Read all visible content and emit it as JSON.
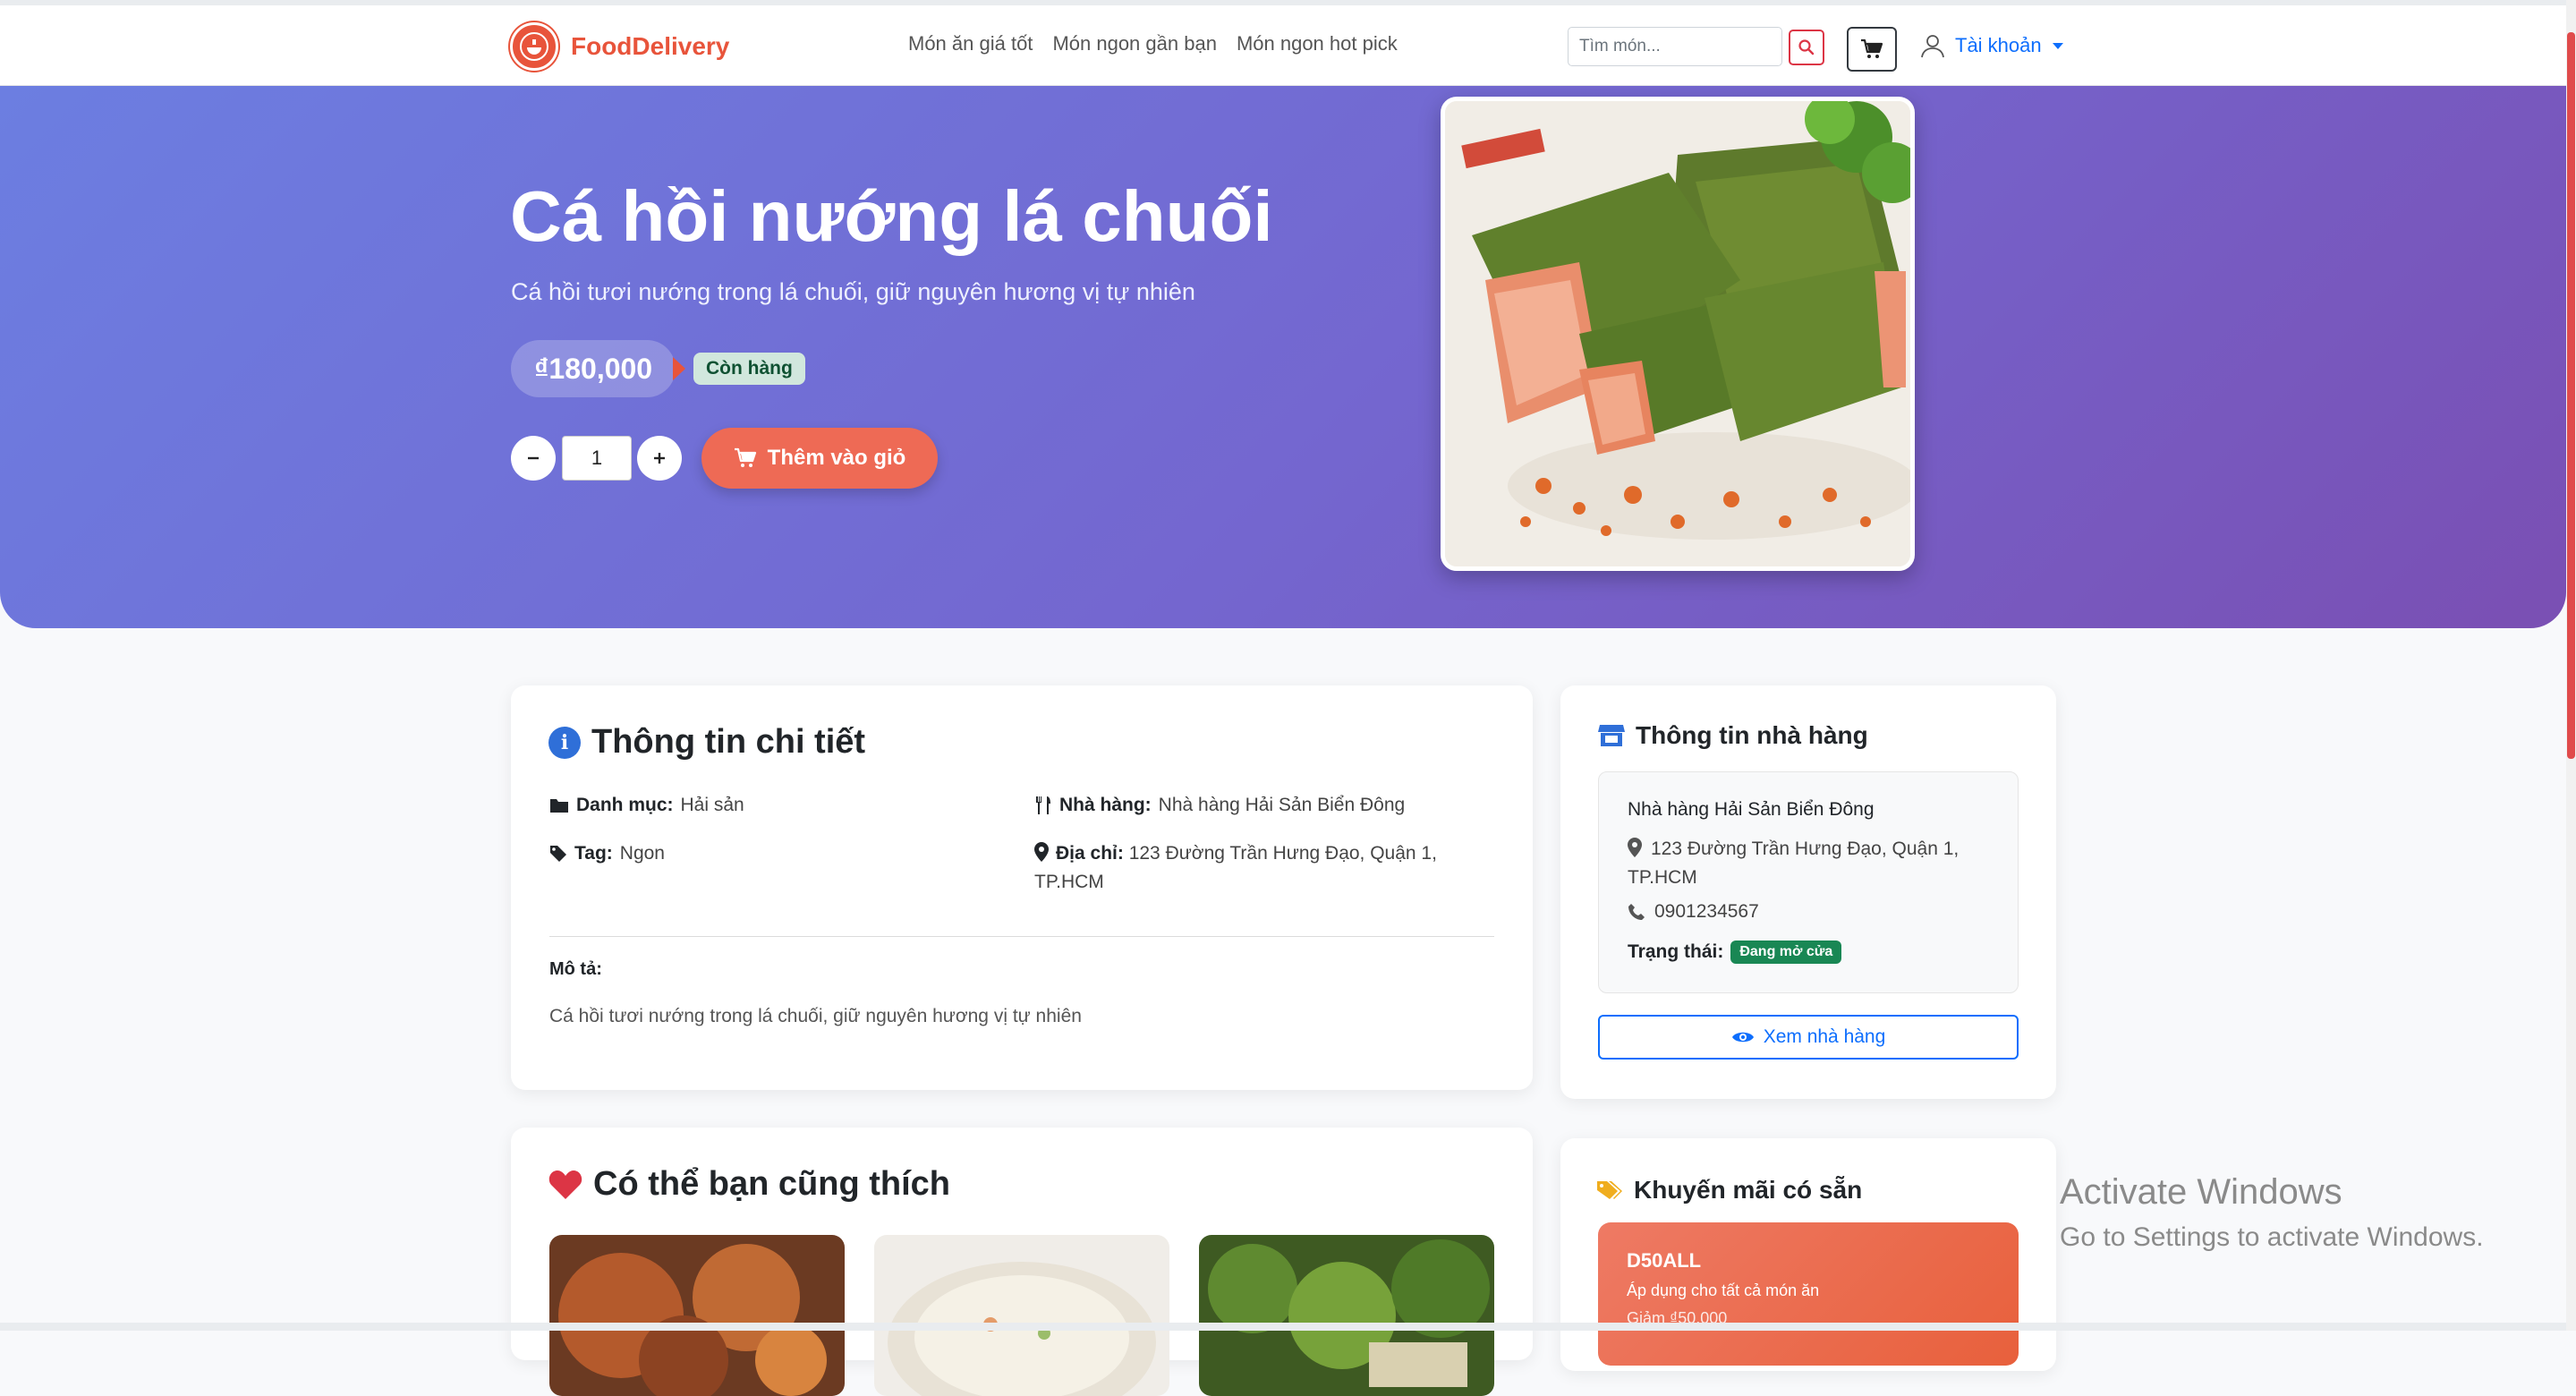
{
  "header": {
    "brand": "FoodDelivery",
    "nav": [
      "Món ăn giá tốt",
      "Món ngon gần bạn",
      "Món ngon hot pick"
    ],
    "search_placeholder": "Tìm món...",
    "account_label": "Tài khoản"
  },
  "hero": {
    "title": "Cá hồi nướng lá chuối",
    "subtitle": "Cá hồi tươi nướng trong lá chuối, giữ nguyên hương vị tự nhiên",
    "price": "₫180,000",
    "stock_status": "Còn hàng",
    "quantity": "1",
    "add_to_cart": "Thêm vào giỏ"
  },
  "details": {
    "title": "Thông tin chi tiết",
    "category_label": "Danh mục:",
    "category": "Hải sản",
    "tag_label": "Tag:",
    "tag": "Ngon",
    "restaurant_label": "Nhà hàng:",
    "restaurant": "Nhà hàng Hải Sản Biển Đông",
    "address_label": "Địa chỉ:",
    "address": "123 Đường Trần Hưng Đạo, Quận 1, TP.HCM",
    "desc_label": "Mô tả:",
    "desc": "Cá hồi tươi nướng trong lá chuối, giữ nguyên hương vị tự nhiên"
  },
  "restaurant_card": {
    "title": "Thông tin nhà hàng",
    "name": "Nhà hàng Hải Sản Biển Đông",
    "address": "123 Đường Trần Hưng Đạo, Quận 1, TP.HCM",
    "phone": "0901234567",
    "status_label": "Trạng thái:",
    "status": "Đang mở cửa",
    "view_button": "Xem nhà hàng"
  },
  "suggestions": {
    "title": "Có thể bạn cũng thích"
  },
  "promotions": {
    "title": "Khuyến mãi có sẵn",
    "items": [
      {
        "code": "D50ALL",
        "desc": "Áp dụng cho tất cả món ăn",
        "discount": "Giảm ₫50,000"
      }
    ]
  },
  "os": {
    "watermark_title": "Activate Windows",
    "watermark_sub": "Go to Settings to activate Windows."
  },
  "colors": {
    "brand": "#e8543b",
    "hero_gradient": [
      "#6c7ee1",
      "#7a4fb3"
    ],
    "primary": "#0d6efd",
    "success": "#198754"
  }
}
